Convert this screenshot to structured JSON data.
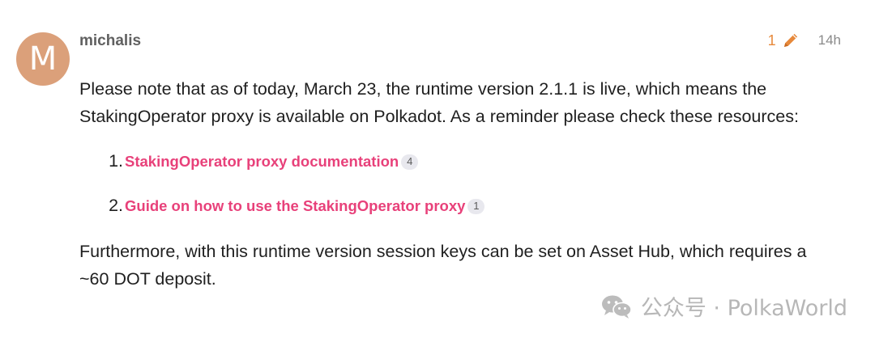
{
  "post": {
    "avatar_letter": "M",
    "username": "michalis",
    "edit_count": "1",
    "time": "14h",
    "paragraph1": "Please note that as of today, March 23, the runtime version 2.1.1 is live, which means the StakingOperator proxy is available on Polkadot. As a reminder please check these resources:",
    "links": [
      {
        "number": "1.",
        "text": "StakingOperator proxy documentation",
        "count": "4"
      },
      {
        "number": "2.",
        "text": "Guide on how to use the StakingOperator proxy",
        "count": "1"
      }
    ],
    "paragraph2": "Furthermore, with this runtime version session keys can be set on Asset Hub, which requires a ~60 DOT deposit."
  },
  "watermark": {
    "text": "公众号 · PolkaWorld",
    "icon": "wechat-icon"
  },
  "colors": {
    "avatar_bg": "#dba07a",
    "link": "#e8417a",
    "edit": "#e7893b"
  }
}
